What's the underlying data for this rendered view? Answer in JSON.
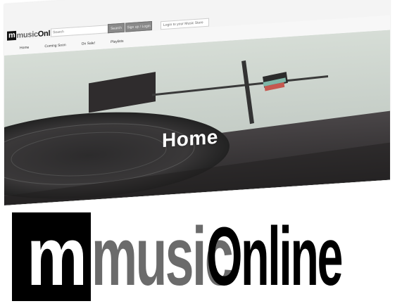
{
  "brand": {
    "m": "m",
    "music": "music",
    "online": "Online"
  },
  "header": {
    "search_placeholder": "Search",
    "button_primary": "Search",
    "button_secondary": "Sign up / Login",
    "login_prompt": "Login to your Music Store"
  },
  "nav": {
    "items": [
      {
        "label": "Home"
      },
      {
        "label": "Coming Soon"
      },
      {
        "label": "On Sale!"
      },
      {
        "label": "Playlists"
      }
    ]
  },
  "hero": {
    "title": "Home"
  },
  "colors": {
    "page_bg": "#ffffff",
    "hero_sky": "#cdd6cf",
    "logo_dark": "#000000",
    "logo_grey": "#6b6b6b"
  }
}
